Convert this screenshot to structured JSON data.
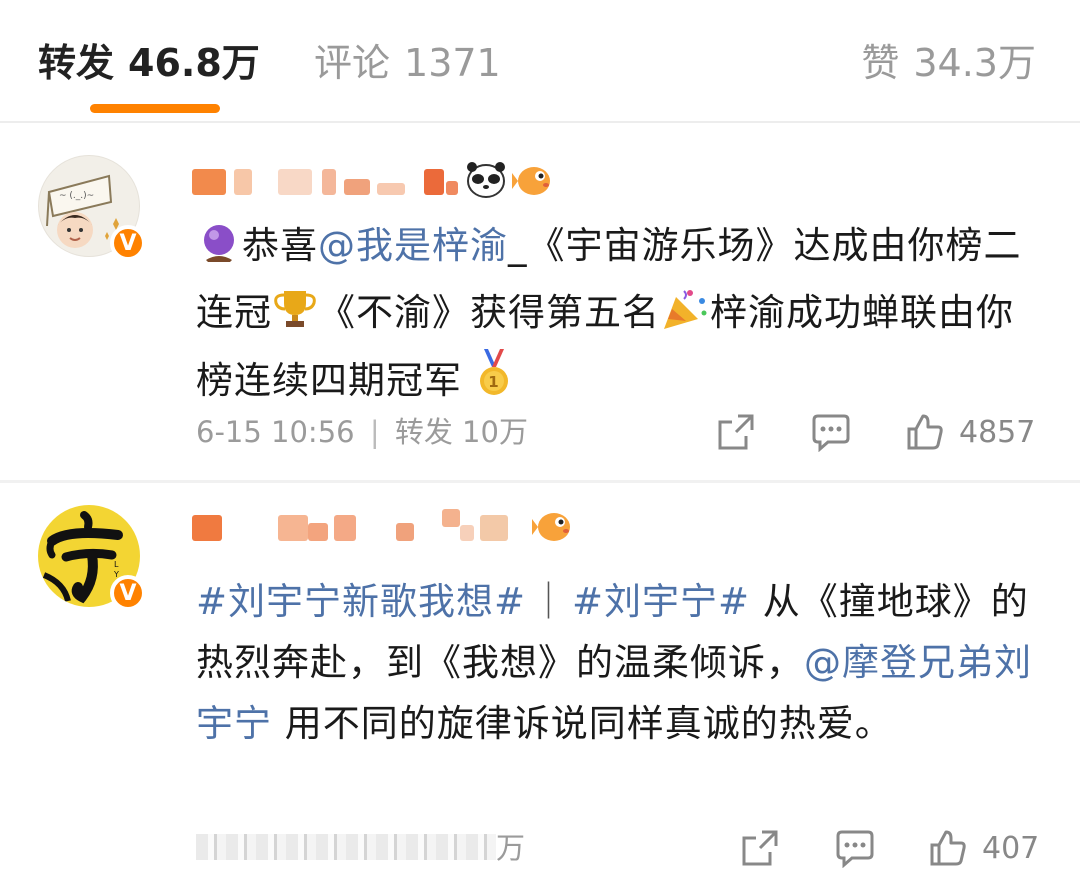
{
  "tabs": {
    "repost": {
      "label": "转发",
      "count": "46.8万"
    },
    "comment": {
      "label": "评论",
      "count": "1371"
    },
    "like": {
      "label": "赞",
      "count": "34.3万"
    }
  },
  "colors": {
    "accent": "#ff8200",
    "link": "#4e72a8",
    "muted": "#9b9b9b"
  },
  "posts": [
    {
      "content": {
        "t1": "恭喜",
        "mention": "@我是梓渝",
        "t2": "_《宇宙游乐场》达成由你榜二连冠",
        "t3": "《不渝》获得第五名",
        "t4": "梓渝成功蝉联由你榜连续四期冠军"
      },
      "meta": {
        "time": "6-15 10:56",
        "sep": "|",
        "repost_label": "转发 10万"
      },
      "likes": "4857",
      "badge": "V"
    },
    {
      "content": {
        "tag1": "#刘宇宁新歌我想#",
        "sep": "｜",
        "tag2": "#刘宇宁#",
        "t1": " 从《撞地球》的热烈奔赴，到《我想》的温柔倾诉，",
        "mention": "@摩登兄弟刘宇宁",
        "t2": " 用不同的旋律诉说同样真诚的热爱。"
      },
      "meta": {
        "repost_label": "万"
      },
      "likes": "407",
      "badge": "V"
    }
  ]
}
